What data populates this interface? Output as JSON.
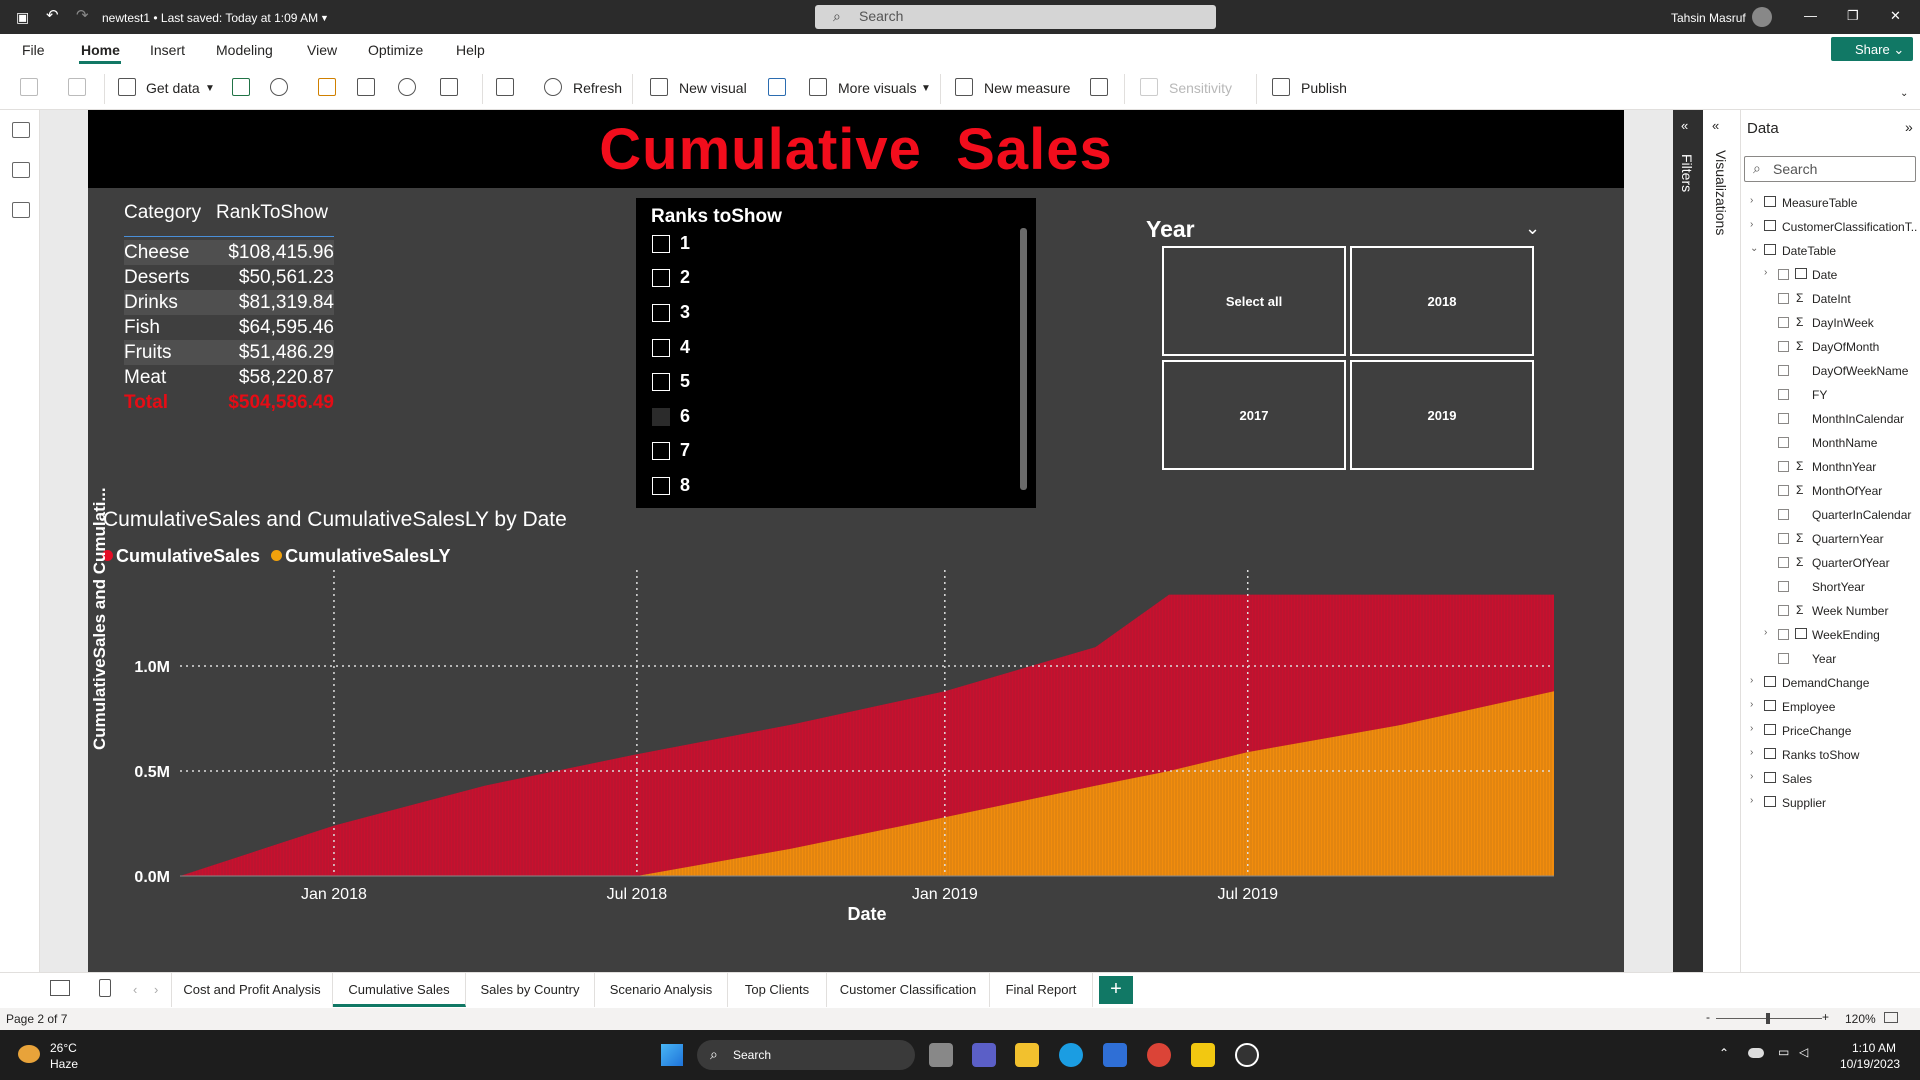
{
  "titlebar": {
    "file_title": "newtest1 • Last saved: Today at 1:09 AM",
    "search_placeholder": "Search",
    "user": "Tahsin Masruf",
    "minimize": "—",
    "restore": "❐",
    "close": "✕"
  },
  "menu": {
    "items": [
      "File",
      "Home",
      "Insert",
      "Modeling",
      "View",
      "Optimize",
      "Help"
    ],
    "share_label": "Share"
  },
  "ribbon": {
    "get_data": "Get data",
    "refresh": "Refresh",
    "new_visual": "New visual",
    "more_visuals": "More visuals",
    "new_measure": "New measure",
    "sensitivity": "Sensitivity",
    "publish": "Publish"
  },
  "report": {
    "title": "Cumulative  Sales"
  },
  "table": {
    "headers": [
      "Category",
      "RankToShow"
    ],
    "rows": [
      {
        "category": "Cheese",
        "value": "$108,415.96"
      },
      {
        "category": "Deserts",
        "value": "$50,561.23"
      },
      {
        "category": "Drinks",
        "value": "$81,319.84"
      },
      {
        "category": "Fish",
        "value": "$64,595.46"
      },
      {
        "category": "Fruits",
        "value": "$51,486.29"
      },
      {
        "category": "Meat",
        "value": "$58,220.87"
      }
    ],
    "total": {
      "label": "Total",
      "value": "$504,586.49"
    }
  },
  "ranks_slicer": {
    "title": "Ranks toShow",
    "items": [
      "1",
      "2",
      "3",
      "4",
      "5",
      "6",
      "7",
      "8"
    ]
  },
  "year_slicer": {
    "title": "Year",
    "tiles": [
      "Select all",
      "2018",
      "2017",
      "2019"
    ]
  },
  "chart_data": {
    "type": "area",
    "title": "CumulativeSales and CumulativeSalesLY by Date",
    "xlabel": "Date",
    "ylabel": "CumulativeSales and Cumulati...",
    "x_ticks": [
      "Jan 2018",
      "Jul 2018",
      "Jan 2019",
      "Jul 2019"
    ],
    "y_ticks": [
      "0.0M",
      "0.5M",
      "1.0M"
    ],
    "ylim": [
      0,
      1400000
    ],
    "x": [
      "2017-10-01",
      "2018-01-01",
      "2018-04-01",
      "2018-07-01",
      "2018-10-01",
      "2019-01-01",
      "2019-04-01",
      "2019-05-15",
      "2019-07-01",
      "2019-10-01",
      "2019-12-31"
    ],
    "series": [
      {
        "name": "CumulativeSales",
        "color": "#c8102e",
        "values": [
          0,
          240000,
          430000,
          580000,
          720000,
          880000,
          1090000,
          1340000,
          1340000,
          1340000,
          1340000
        ]
      },
      {
        "name": "CumulativeSalesLY",
        "color": "#f28c0c",
        "values": [
          null,
          null,
          null,
          0,
          130000,
          280000,
          430000,
          500000,
          590000,
          720000,
          880000
        ]
      }
    ],
    "grid": true,
    "legend": "top-left"
  },
  "data_pane": {
    "title": "Data",
    "search_placeholder": "Search",
    "tables": [
      {
        "name": "MeasureTable"
      },
      {
        "name": "CustomerClassificationT..."
      },
      {
        "name": "DateTable",
        "expanded": true,
        "fields": [
          "Date",
          "DateInt",
          "DayInWeek",
          "DayOfMonth",
          "DayOfWeekName",
          "FY",
          "MonthInCalendar",
          "MonthName",
          "MonthnYear",
          "MonthOfYear",
          "QuarterInCalendar",
          "QuarternYear",
          "QuarterOfYear",
          "ShortYear",
          "Week Number",
          "WeekEnding",
          "Year"
        ]
      },
      {
        "name": "DemandChange"
      },
      {
        "name": "Employee"
      },
      {
        "name": "PriceChange"
      },
      {
        "name": "Ranks toShow"
      },
      {
        "name": "Sales"
      },
      {
        "name": "Supplier"
      }
    ]
  },
  "side_labels": {
    "filters": "Filters",
    "visualizations": "Visualizations"
  },
  "tabs": [
    "Cost and Profit Analysis",
    "Cumulative Sales",
    "Sales by Country",
    "Scenario Analysis",
    "Top Clients",
    "Customer Classification",
    "Final Report"
  ],
  "add_tab": "+",
  "status": {
    "page": "Page 2 of 7",
    "zoom": "120%"
  },
  "taskbar": {
    "weather_temp": "26°C",
    "weather_desc": "Haze",
    "search": "Search",
    "time": "1:10 AM",
    "date": "10/19/2023"
  }
}
